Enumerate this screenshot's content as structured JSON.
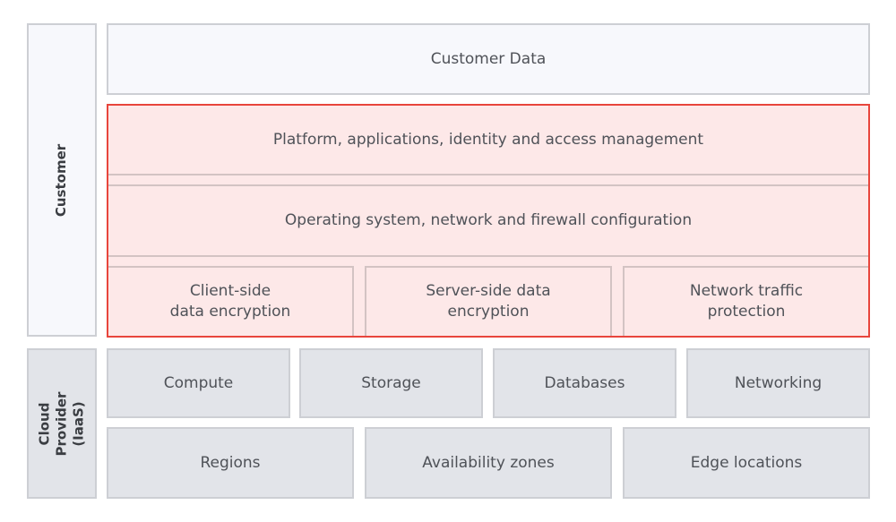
{
  "customer": {
    "label": "Customer",
    "customer_data": "Customer Data",
    "platform": "Platform, applications, identity and access management",
    "os": "Operating system, network and firewall configuration",
    "encryption": [
      "Client-side\ndata encryption",
      "Server-side data\nencryption",
      "Network traffic\nprotection"
    ]
  },
  "provider": {
    "label": "Cloud Provider\n(IaaS)",
    "services": [
      "Compute",
      "Storage",
      "Databases",
      "Networking"
    ],
    "infrastructure": [
      "Regions",
      "Availability zones",
      "Edge locations"
    ]
  },
  "colors": {
    "highlight_border": "#e8453c",
    "highlight_fill": "#fde8e8",
    "provider_fill": "#e2e4e9",
    "customer_fill": "#f7f8fc"
  }
}
